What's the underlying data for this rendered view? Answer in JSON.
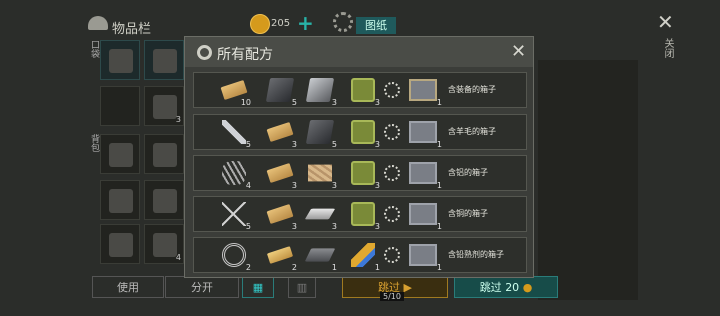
{
  "header": {
    "inventory_title": "物品栏",
    "coins": "205",
    "plus": "+",
    "blueprint_tab": "图纸",
    "close_label": "关闭"
  },
  "side_labels": {
    "top": "口袋",
    "bottom": "背包"
  },
  "inventory_cells": [
    {
      "icon": "shotgun-icon",
      "count": ""
    },
    {
      "icon": "armor-icon",
      "count": ""
    },
    {
      "icon": "empty-slot",
      "count": ""
    },
    {
      "icon": "wires-icon",
      "count": "3"
    },
    {
      "icon": "helmet-icon",
      "count": ""
    },
    {
      "icon": "boots-icon",
      "count": ""
    },
    {
      "icon": "propeller-icon",
      "count": ""
    },
    {
      "icon": "cleaver-icon",
      "count": ""
    },
    {
      "icon": "crowbar-icon",
      "count": ""
    },
    {
      "icon": "backpack-icon",
      "count": "4"
    }
  ],
  "bottom_bar": {
    "use": "使用",
    "split": "分开",
    "skip": "跳过",
    "skip_counter": "5/10",
    "skip_coins": "跳过",
    "skip_cost": "20"
  },
  "modal": {
    "title": "所有配方",
    "recipes": [
      {
        "ingredients": [
          {
            "icon": "plank-icon",
            "qty": "10"
          },
          {
            "icon": "dark-sheet-icon",
            "qty": "5"
          },
          {
            "icon": "sheet-metal-icon",
            "qty": "3"
          },
          {
            "icon": "jerrycan-icon",
            "qty": "3"
          }
        ],
        "result": {
          "icon": "crate-icon",
          "qty": "1",
          "name": "含装备的箱子"
        }
      },
      {
        "ingredients": [
          {
            "icon": "wrench-icon",
            "qty": "5"
          },
          {
            "icon": "plank-icon",
            "qty": "3"
          },
          {
            "icon": "dark-sheet-icon",
            "qty": "5"
          },
          {
            "icon": "jerrycan-icon",
            "qty": "3"
          }
        ],
        "result": {
          "icon": "metal-crate-icon",
          "qty": "1",
          "name": "含羊毛的箱子"
        }
      },
      {
        "ingredients": [
          {
            "icon": "spring-icon",
            "qty": "4"
          },
          {
            "icon": "plank-icon",
            "qty": "3"
          },
          {
            "icon": "cardboard-icon",
            "qty": "3"
          },
          {
            "icon": "jerrycan-icon",
            "qty": "3"
          }
        ],
        "result": {
          "icon": "metal-crate-icon",
          "qty": "1",
          "name": "含铝的箱子"
        }
      },
      {
        "ingredients": [
          {
            "icon": "nails-icon",
            "qty": "5"
          },
          {
            "icon": "plank-icon",
            "qty": "3"
          },
          {
            "icon": "ingots-icon",
            "qty": "3"
          },
          {
            "icon": "jerrycan-icon",
            "qty": "3"
          }
        ],
        "result": {
          "icon": "metal-crate-icon",
          "qty": "1",
          "name": "含铜的箱子"
        }
      },
      {
        "ingredients": [
          {
            "icon": "wire-coil-icon",
            "qty": "2"
          },
          {
            "icon": "gold-plank-icon",
            "qty": "2"
          },
          {
            "icon": "lead-bar-icon",
            "qty": "1"
          },
          {
            "icon": "glue-icon",
            "qty": "1"
          }
        ],
        "result": {
          "icon": "metal-crate-icon",
          "qty": "1",
          "name": "含铅熟剂的箱子"
        }
      }
    ]
  }
}
